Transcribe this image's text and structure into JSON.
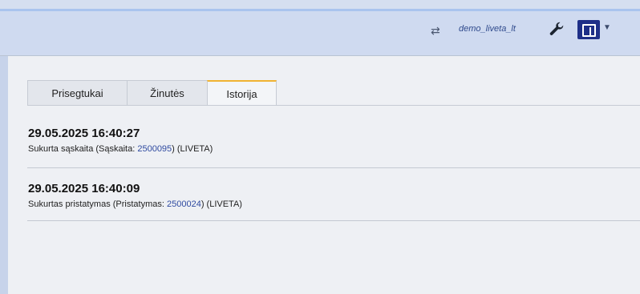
{
  "header": {
    "switch_icon": "swap-arrows-icon",
    "user_name": "demo_liveta_lt",
    "wrench_icon": "wrench-icon",
    "layout_icon": "layout-toggle-icon",
    "caret_icon": "chevron-down-icon"
  },
  "tabs": [
    {
      "label": "Prisegtukai",
      "active": false
    },
    {
      "label": "Žinutės",
      "active": false
    },
    {
      "label": "Istorija",
      "active": true
    }
  ],
  "history": [
    {
      "datetime": "29.05.2025 16:40:27",
      "text_before": "Sukurta sąskaita (Sąskaita: ",
      "link": "2500095",
      "text_after": ") (LIVETA)"
    },
    {
      "datetime": "29.05.2025 16:40:09",
      "text_before": "Sukurtas pristatymas (Pristatymas: ",
      "link": "2500024",
      "text_after": ") (LIVETA)"
    }
  ],
  "colors": {
    "header_bg": "#cfdaf0",
    "accent_tab": "#f0b332",
    "link": "#2f4aa0",
    "layout_button": "#1f2f88"
  }
}
